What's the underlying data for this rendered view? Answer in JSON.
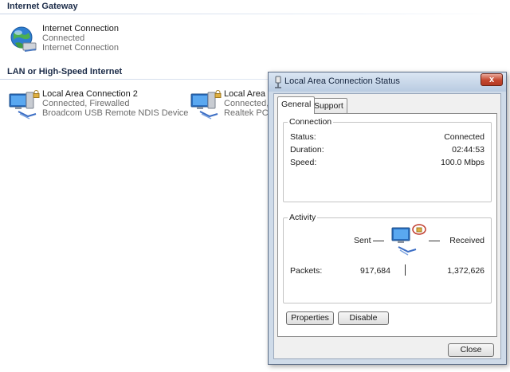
{
  "groups": [
    {
      "title": "Internet Gateway"
    },
    {
      "title": "LAN or High-Speed Internet"
    }
  ],
  "connections": [
    {
      "name": "Internet Connection",
      "status": "Connected",
      "detail": "Internet Connection",
      "icon": "internet-globe-icon"
    },
    {
      "name": "Local Area Connection 2",
      "status": "Connected, Firewalled",
      "detail": "Broadcom USB Remote NDIS Device",
      "icon": "network-computer-icon"
    },
    {
      "name": "Local Area C",
      "status": "Connected, F",
      "detail": "Realtek PCIe",
      "icon": "network-computer-icon"
    }
  ],
  "dialog": {
    "title": "Local Area Connection Status",
    "close_glyph": "x",
    "tabs": [
      "General",
      "Support"
    ],
    "active_tab": "General",
    "connection": {
      "legend": "Connection",
      "rows": [
        {
          "label": "Status:",
          "value": "Connected"
        },
        {
          "label": "Duration:",
          "value": "02:44:53"
        },
        {
          "label": "Speed:",
          "value": "100.0 Mbps"
        }
      ]
    },
    "activity": {
      "legend": "Activity",
      "sent_label": "Sent",
      "received_label": "Received",
      "packets_label": "Packets:",
      "sent_packets": "917,684",
      "received_packets": "1,372,626"
    },
    "buttons": {
      "properties": "Properties",
      "disable": "Disable",
      "close": "Close"
    }
  },
  "colors": {
    "titlebar": "#cfdbe9",
    "close_button": "#c4472e",
    "group_header": "#1b2b48"
  }
}
